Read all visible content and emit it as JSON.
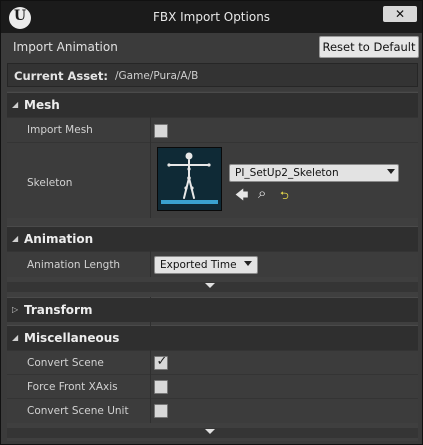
{
  "window": {
    "title": "FBX Import Options",
    "logo_glyph": "U",
    "close_glyph": "✕"
  },
  "header": {
    "label": "Import Animation",
    "reset_label": "Reset to Default"
  },
  "asset": {
    "label": "Current Asset:",
    "path": "/Game/Pura/A/B"
  },
  "sections": {
    "mesh": {
      "title": "Mesh",
      "expanded": true,
      "import_mesh_label": "Import Mesh",
      "import_mesh_checked": false,
      "skeleton_label": "Skeleton",
      "skeleton_value": "PI_SetUp2_Skeleton"
    },
    "animation": {
      "title": "Animation",
      "expanded": true,
      "length_label": "Animation Length",
      "length_value": "Exported Time"
    },
    "transform": {
      "title": "Transform",
      "expanded": false
    },
    "misc": {
      "title": "Miscellaneous",
      "expanded": true,
      "convert_scene_label": "Convert Scene",
      "convert_scene_checked": true,
      "force_front_label": "Force Front XAxis",
      "force_front_checked": false,
      "convert_unit_label": "Convert Scene Unit",
      "convert_unit_checked": false
    }
  },
  "icons": {
    "expanded_arrow": "◢",
    "collapsed_arrow": "▷",
    "checkmark": "✓",
    "back": "🡄",
    "browse": "⌕",
    "reset_value": "⮌"
  },
  "colors": {
    "title_bar": "#1b1b1b",
    "panel": "#3f3f3f",
    "category": "#2f2f2f",
    "thumbnail_bg": "#0f2a36",
    "thumbnail_floor": "#3aa2d0",
    "reset_arrow": "#e6d84a"
  }
}
